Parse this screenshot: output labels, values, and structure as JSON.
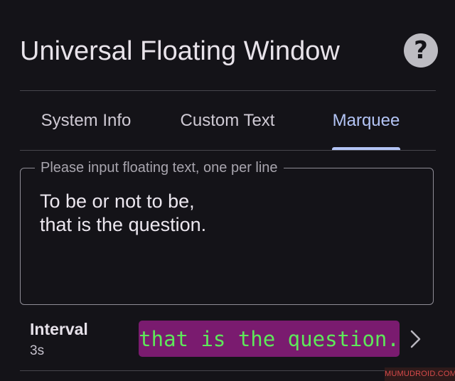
{
  "header": {
    "title": "Universal Floating Window",
    "help_glyph": "?",
    "help_icon": "question-mark-icon"
  },
  "tabs": [
    {
      "label": "System Info",
      "active": false
    },
    {
      "label": "Custom Text",
      "active": false
    },
    {
      "label": "Marquee",
      "active": true
    }
  ],
  "text_field": {
    "label": "Please input floating text, one per line",
    "lines": [
      "To be or not to be,",
      "that is the question."
    ]
  },
  "interval": {
    "label": "Interval",
    "value": "3s",
    "preview_text": "that is the question.",
    "preview_bg": "#7a1b6f",
    "preview_fg": "#5ee85a",
    "chevron_icon": "chevron-right-icon"
  },
  "watermark": "MUMUDROID.COM",
  "colors": {
    "background": "#141318",
    "accent": "#b3c4f5",
    "divider": "#47464c"
  }
}
